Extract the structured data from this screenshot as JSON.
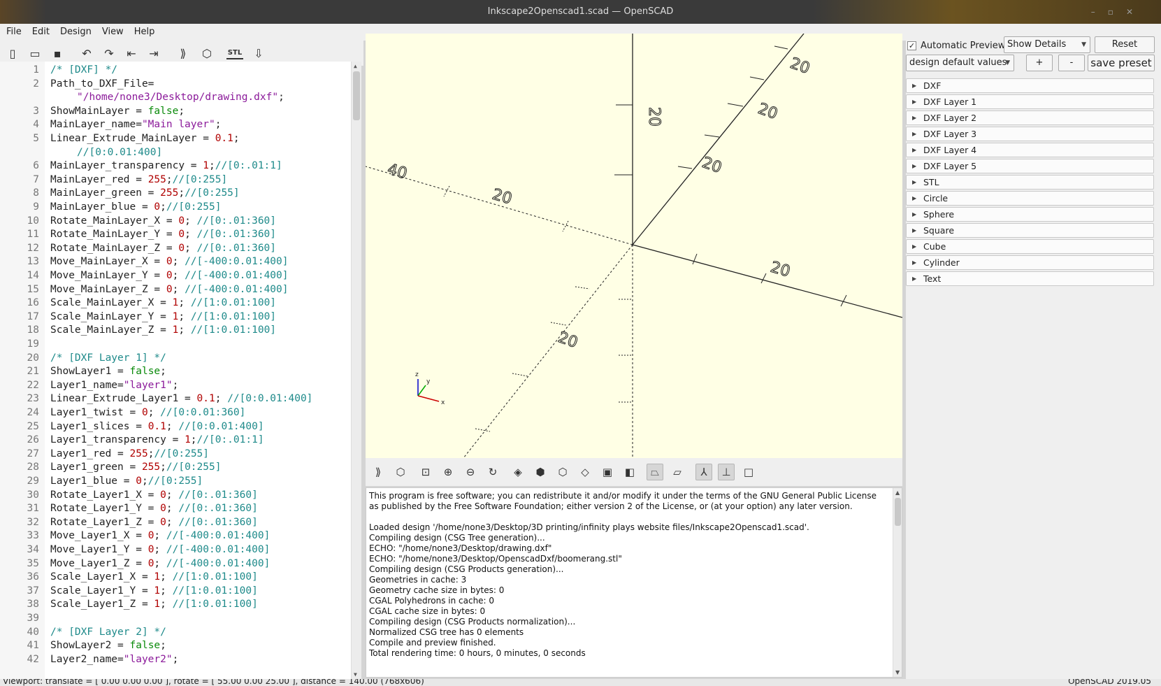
{
  "window": {
    "title": "Inkscape2Openscad1.scad — OpenSCAD"
  },
  "menu": [
    "File",
    "Edit",
    "Design",
    "View",
    "Help"
  ],
  "editor": {
    "lines": [
      {
        "n": "1",
        "parts": [
          [
            "c",
            "/* [DXF] */"
          ]
        ]
      },
      {
        "n": "2",
        "parts": [
          [
            "t",
            "Path_to_DXF_File="
          ]
        ],
        "cont": [
          [
            "s",
            "\"/home/none3/Desktop/drawing.dxf\""
          ],
          [
            "t",
            ";"
          ]
        ]
      },
      {
        "n": "3",
        "parts": [
          [
            "t",
            "ShowMainLayer = "
          ],
          [
            "k",
            "false"
          ],
          [
            "t",
            ";"
          ]
        ]
      },
      {
        "n": "4",
        "parts": [
          [
            "t",
            "MainLayer_name="
          ],
          [
            "s",
            "\"Main layer\""
          ],
          [
            "t",
            ";"
          ]
        ]
      },
      {
        "n": "5",
        "parts": [
          [
            "t",
            "Linear_Extrude_MainLayer = "
          ],
          [
            "n",
            "0.1"
          ],
          [
            "t",
            ";"
          ]
        ],
        "cont": [
          [
            "c",
            "//[0:0.01:400]"
          ]
        ]
      },
      {
        "n": "6",
        "parts": [
          [
            "t",
            "MainLayer_transparency = "
          ],
          [
            "n",
            "1"
          ],
          [
            "t",
            ";"
          ],
          [
            "c",
            "//[0:.01:1]"
          ]
        ]
      },
      {
        "n": "7",
        "parts": [
          [
            "t",
            "MainLayer_red = "
          ],
          [
            "n",
            "255"
          ],
          [
            "t",
            ";"
          ],
          [
            "c",
            "//[0:255]"
          ]
        ]
      },
      {
        "n": "8",
        "parts": [
          [
            "t",
            "MainLayer_green = "
          ],
          [
            "n",
            "255"
          ],
          [
            "t",
            ";"
          ],
          [
            "c",
            "//[0:255]"
          ]
        ]
      },
      {
        "n": "9",
        "parts": [
          [
            "t",
            "MainLayer_blue = "
          ],
          [
            "n",
            "0"
          ],
          [
            "t",
            ";"
          ],
          [
            "c",
            "//[0:255]"
          ]
        ]
      },
      {
        "n": "10",
        "parts": [
          [
            "t",
            "Rotate_MainLayer_X = "
          ],
          [
            "n",
            "0"
          ],
          [
            "t",
            "; "
          ],
          [
            "c",
            "//[0:.01:360]"
          ]
        ]
      },
      {
        "n": "11",
        "parts": [
          [
            "t",
            "Rotate_MainLayer_Y = "
          ],
          [
            "n",
            "0"
          ],
          [
            "t",
            "; "
          ],
          [
            "c",
            "//[0:.01:360]"
          ]
        ]
      },
      {
        "n": "12",
        "parts": [
          [
            "t",
            "Rotate_MainLayer_Z = "
          ],
          [
            "n",
            "0"
          ],
          [
            "t",
            "; "
          ],
          [
            "c",
            "//[0:.01:360]"
          ]
        ]
      },
      {
        "n": "13",
        "parts": [
          [
            "t",
            "Move_MainLayer_X = "
          ],
          [
            "n",
            "0"
          ],
          [
            "t",
            "; "
          ],
          [
            "c",
            "//[-400:0.01:400]"
          ]
        ]
      },
      {
        "n": "14",
        "parts": [
          [
            "t",
            "Move_MainLayer_Y = "
          ],
          [
            "n",
            "0"
          ],
          [
            "t",
            "; "
          ],
          [
            "c",
            "//[-400:0.01:400]"
          ]
        ]
      },
      {
        "n": "15",
        "parts": [
          [
            "t",
            "Move_MainLayer_Z = "
          ],
          [
            "n",
            "0"
          ],
          [
            "t",
            "; "
          ],
          [
            "c",
            "//[-400:0.01:400]"
          ]
        ]
      },
      {
        "n": "16",
        "parts": [
          [
            "t",
            "Scale_MainLayer_X = "
          ],
          [
            "n",
            "1"
          ],
          [
            "t",
            "; "
          ],
          [
            "c",
            "//[1:0.01:100]"
          ]
        ]
      },
      {
        "n": "17",
        "parts": [
          [
            "t",
            "Scale_MainLayer_Y = "
          ],
          [
            "n",
            "1"
          ],
          [
            "t",
            "; "
          ],
          [
            "c",
            "//[1:0.01:100]"
          ]
        ]
      },
      {
        "n": "18",
        "parts": [
          [
            "t",
            "Scale_MainLayer_Z = "
          ],
          [
            "n",
            "1"
          ],
          [
            "t",
            "; "
          ],
          [
            "c",
            "//[1:0.01:100]"
          ]
        ]
      },
      {
        "n": "19",
        "parts": []
      },
      {
        "n": "20",
        "parts": [
          [
            "c",
            "/* [DXF Layer 1] */"
          ]
        ]
      },
      {
        "n": "21",
        "parts": [
          [
            "t",
            "ShowLayer1 = "
          ],
          [
            "k",
            "false"
          ],
          [
            "t",
            ";"
          ]
        ]
      },
      {
        "n": "22",
        "parts": [
          [
            "t",
            "Layer1_name="
          ],
          [
            "s",
            "\"layer1\""
          ],
          [
            "t",
            ";"
          ]
        ]
      },
      {
        "n": "23",
        "parts": [
          [
            "t",
            "Linear_Extrude_Layer1 = "
          ],
          [
            "n",
            "0.1"
          ],
          [
            "t",
            "; "
          ],
          [
            "c",
            "//[0:0.01:400]"
          ]
        ]
      },
      {
        "n": "24",
        "parts": [
          [
            "t",
            "Layer1_twist = "
          ],
          [
            "n",
            "0"
          ],
          [
            "t",
            "; "
          ],
          [
            "c",
            "//[0:0.01:360]"
          ]
        ]
      },
      {
        "n": "25",
        "parts": [
          [
            "t",
            "Layer1_slices = "
          ],
          [
            "n",
            "0.1"
          ],
          [
            "t",
            "; "
          ],
          [
            "c",
            "//[0:0.01:400]"
          ]
        ]
      },
      {
        "n": "26",
        "parts": [
          [
            "t",
            "Layer1_transparency = "
          ],
          [
            "n",
            "1"
          ],
          [
            "t",
            ";"
          ],
          [
            "c",
            "//[0:.01:1]"
          ]
        ]
      },
      {
        "n": "27",
        "parts": [
          [
            "t",
            "Layer1_red = "
          ],
          [
            "n",
            "255"
          ],
          [
            "t",
            ";"
          ],
          [
            "c",
            "//[0:255]"
          ]
        ]
      },
      {
        "n": "28",
        "parts": [
          [
            "t",
            "Layer1_green = "
          ],
          [
            "n",
            "255"
          ],
          [
            "t",
            ";"
          ],
          [
            "c",
            "//[0:255]"
          ]
        ]
      },
      {
        "n": "29",
        "parts": [
          [
            "t",
            "Layer1_blue = "
          ],
          [
            "n",
            "0"
          ],
          [
            "t",
            ";"
          ],
          [
            "c",
            "//[0:255]"
          ]
        ]
      },
      {
        "n": "30",
        "parts": [
          [
            "t",
            "Rotate_Layer1_X = "
          ],
          [
            "n",
            "0"
          ],
          [
            "t",
            "; "
          ],
          [
            "c",
            "//[0:.01:360]"
          ]
        ]
      },
      {
        "n": "31",
        "parts": [
          [
            "t",
            "Rotate_Layer1_Y = "
          ],
          [
            "n",
            "0"
          ],
          [
            "t",
            "; "
          ],
          [
            "c",
            "//[0:.01:360]"
          ]
        ]
      },
      {
        "n": "32",
        "parts": [
          [
            "t",
            "Rotate_Layer1_Z = "
          ],
          [
            "n",
            "0"
          ],
          [
            "t",
            "; "
          ],
          [
            "c",
            "//[0:.01:360]"
          ]
        ]
      },
      {
        "n": "33",
        "parts": [
          [
            "t",
            "Move_Layer1_X = "
          ],
          [
            "n",
            "0"
          ],
          [
            "t",
            "; "
          ],
          [
            "c",
            "//[-400:0.01:400]"
          ]
        ]
      },
      {
        "n": "34",
        "parts": [
          [
            "t",
            "Move_Layer1_Y = "
          ],
          [
            "n",
            "0"
          ],
          [
            "t",
            "; "
          ],
          [
            "c",
            "//[-400:0.01:400]"
          ]
        ]
      },
      {
        "n": "35",
        "parts": [
          [
            "t",
            "Move_Layer1_Z = "
          ],
          [
            "n",
            "0"
          ],
          [
            "t",
            "; "
          ],
          [
            "c",
            "//[-400:0.01:400]"
          ]
        ]
      },
      {
        "n": "36",
        "parts": [
          [
            "t",
            "Scale_Layer1_X = "
          ],
          [
            "n",
            "1"
          ],
          [
            "t",
            "; "
          ],
          [
            "c",
            "//[1:0.01:100]"
          ]
        ]
      },
      {
        "n": "37",
        "parts": [
          [
            "t",
            "Scale_Layer1_Y = "
          ],
          [
            "n",
            "1"
          ],
          [
            "t",
            "; "
          ],
          [
            "c",
            "//[1:0.01:100]"
          ]
        ]
      },
      {
        "n": "38",
        "parts": [
          [
            "t",
            "Scale_Layer1_Z = "
          ],
          [
            "n",
            "1"
          ],
          [
            "t",
            "; "
          ],
          [
            "c",
            "//[1:0.01:100]"
          ]
        ]
      },
      {
        "n": "39",
        "parts": []
      },
      {
        "n": "40",
        "parts": [
          [
            "c",
            "/* [DXF Layer 2] */"
          ]
        ]
      },
      {
        "n": "41",
        "parts": [
          [
            "t",
            "ShowLayer2 = "
          ],
          [
            "k",
            "false"
          ],
          [
            "t",
            ";"
          ]
        ]
      },
      {
        "n": "42",
        "parts": [
          [
            "t",
            "Layer2_name="
          ],
          [
            "s",
            "\"layer2\""
          ],
          [
            "t",
            ";"
          ]
        ]
      }
    ]
  },
  "viewport": {
    "axis_labels": [
      "20",
      "20",
      "20",
      "20",
      "40",
      "20",
      "20",
      "20"
    ],
    "axes_indicator": [
      "z",
      "y",
      "x"
    ],
    "colors": {
      "background": "#ffffe5",
      "axis": "#222222",
      "x_axis_small": "#cc0000",
      "y_axis_small": "#00aa00",
      "z_axis_small": "#0000cc"
    }
  },
  "console": {
    "lines": [
      "This program is free software; you can redistribute it and/or modify it under the terms of the GNU General Public License",
      "as published by the Free Software Foundation; either version 2 of the License, or (at your option) any later version.",
      "",
      "Loaded design '/home/none3/Desktop/3D printing/infinity plays website files/Inkscape2Openscad1.scad'.",
      "Compiling design (CSG Tree generation)...",
      "ECHO: \"/home/none3/Desktop/drawing.dxf\"",
      "ECHO: \"/home/none3/Desktop/OpenscadDxf/boomerang.stl\"",
      "Compiling design (CSG Products generation)...",
      "Geometries in cache: 3",
      "Geometry cache size in bytes: 0",
      "CGAL Polyhedrons in cache: 0",
      "CGAL cache size in bytes: 0",
      "Compiling design (CSG Products normalization)...",
      "Normalized CSG tree has 0 elements",
      "Compile and preview finished.",
      "Total rendering time: 0 hours, 0 minutes, 0 seconds"
    ]
  },
  "customizer": {
    "auto_preview_label": "Automatic Preview",
    "auto_preview_checked": true,
    "details_select": "Show Details",
    "reset_label": "Reset",
    "preset_select": "design default values",
    "plus_label": "+",
    "minus_label": "-",
    "save_preset_label": "save preset",
    "groups": [
      "DXF",
      "DXF Layer 1",
      "DXF Layer 2",
      "DXF Layer 3",
      "DXF Layer 4",
      "DXF Layer 5",
      "STL",
      "Circle",
      "Sphere",
      "Square",
      "Cube",
      "Cylinder",
      "Text"
    ]
  },
  "statusbar": {
    "left": "Viewport: translate = [ 0.00 0.00 0.00 ], rotate = [ 55.00 0.00 25.00 ], distance = 140.00 (768x606)",
    "right": "OpenSCAD 2019.05"
  }
}
